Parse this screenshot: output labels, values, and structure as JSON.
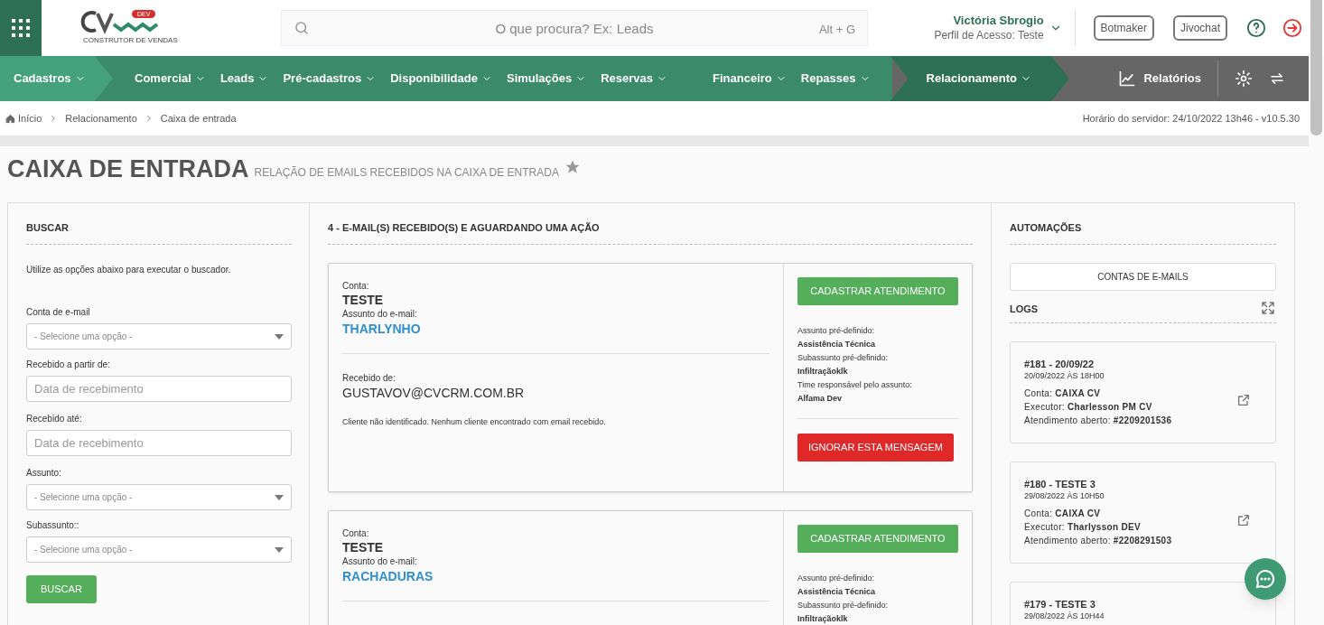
{
  "header": {
    "logo_badge": "DEV",
    "logo_caption": "CONSTRUTOR DE VENDAS",
    "search": {
      "placeholder": "O que procura? Ex: Leads",
      "shortcut": "Alt + G"
    },
    "user": {
      "name": "Victória Sbrogio",
      "profile": "Perfil de Acesso: Teste"
    },
    "buttons": [
      "Botmaker",
      "Jivochat"
    ]
  },
  "nav": {
    "groups": [
      {
        "kind": "light",
        "items": [
          {
            "label": "Cadastros",
            "selected": false
          }
        ]
      },
      {
        "kind": "mid",
        "items": [
          {
            "label": "Comercial",
            "selected": false
          },
          {
            "label": "Leads",
            "selected": false
          },
          {
            "label": "Pré-cadastros",
            "selected": false
          },
          {
            "label": "Disponibilidade",
            "selected": false
          },
          {
            "label": "Simulações",
            "selected": false
          },
          {
            "label": "Reservas",
            "selected": false
          }
        ]
      },
      {
        "kind": "mid",
        "items": [
          {
            "label": "Financeiro",
            "selected": false
          },
          {
            "label": "Repasses",
            "selected": false
          }
        ]
      },
      {
        "kind": "dark",
        "items": [
          {
            "label": "Relacionamento",
            "selected": true
          }
        ]
      }
    ],
    "reports": "Relatórios"
  },
  "breadcrumb": [
    "Início",
    "Relacionamento",
    "Caixa de entrada"
  ],
  "server_time": "Horário do servidor: 24/10/2022 13h46 - v10.5.30",
  "page": {
    "title": "CAIXA DE ENTRADA",
    "subtitle": "RELAÇÃO DE EMAILS RECEBIDOS NA CAIXA DE ENTRADA"
  },
  "search_panel": {
    "title": "BUSCAR",
    "hint": "Utilize as opções abaixo para executar o buscador.",
    "fields": [
      {
        "kind": "select",
        "label": "Conta de e-mail",
        "placeholder": "- Selecione uma opção -"
      },
      {
        "kind": "input",
        "label": "Recebido a partir de:",
        "placeholder": "Data de recebimento"
      },
      {
        "kind": "input",
        "label": "Recebido até:",
        "placeholder": "Data de recebimento"
      },
      {
        "kind": "select",
        "label": "Assunto:",
        "placeholder": "- Selecione uma opção -"
      },
      {
        "kind": "select",
        "label": "Subassunto::",
        "placeholder": "- Selecione uma opção -"
      }
    ],
    "button": "BUSCAR"
  },
  "inbox": {
    "title": "4 - E-MAIL(S) RECEBIDO(S) E AGUARDANDO UMA AÇÃO",
    "emails": [
      {
        "account_label": "Conta:",
        "account": "TESTE",
        "subject_label": "Assunto do e-mail:",
        "subject": "THARLYNHO",
        "received_label": "Recebido de:",
        "received_from": "GUSTAVOV@CVCRM.COM.BR",
        "note": "Cliente não identificado. Nenhum cliente encontrado com email recebido.",
        "register_button": "CADASTRAR ATENDIMENTO",
        "predefined": [
          {
            "label": "Assunto pré-definido:",
            "value": "Assistência Técnica"
          },
          {
            "label": "Subassunto pré-definido:",
            "value": "Infiltraçãoklk"
          },
          {
            "label": "Time responsável pelo assunto:",
            "value": "Alfama Dev"
          }
        ],
        "ignore_button": "IGNORAR ESTA MENSAGEM"
      },
      {
        "account_label": "Conta:",
        "account": "TESTE",
        "subject_label": "Assunto do e-mail:",
        "subject": "RACHADURAS",
        "register_button": "CADASTRAR ATENDIMENTO",
        "predefined": [
          {
            "label": "Assunto pré-definido:",
            "value": "Assistência Técnica"
          },
          {
            "label": "Subassunto pré-definido:",
            "value": "Infiltraçãoklk"
          }
        ]
      }
    ]
  },
  "automations": {
    "title": "AUTOMAÇÕES",
    "accounts_button": "CONTAS DE E-MAILS",
    "logs_title": "LOGS",
    "logs": [
      {
        "title": "#181 - 20/09/22",
        "date": "20/09/2022 ÀS 18H00",
        "fields": [
          {
            "label": "Conta:",
            "value": "CAIXA CV"
          },
          {
            "label": "Executor:",
            "value": "Charlesson PM CV"
          },
          {
            "label": "Atendimento aberto:",
            "value": "#2209201536"
          }
        ]
      },
      {
        "title": "#180 - TESTE 3",
        "date": "29/08/2022 ÀS 10H50",
        "fields": [
          {
            "label": "Conta:",
            "value": "CAIXA CV"
          },
          {
            "label": "Executor:",
            "value": "Tharlysson DEV"
          },
          {
            "label": "Atendimento aberto:",
            "value": "#2208291503"
          }
        ]
      },
      {
        "title": "#179 - TESTE 3",
        "date": "29/08/2022 ÀS 10H44"
      }
    ]
  }
}
